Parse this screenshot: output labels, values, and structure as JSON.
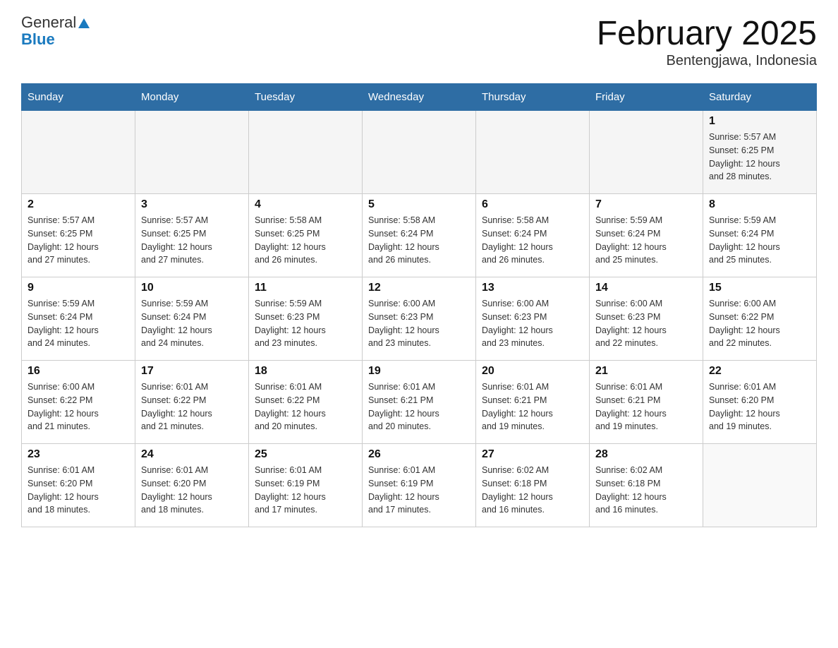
{
  "header": {
    "logo": {
      "general": "General",
      "blue": "Blue"
    },
    "title": "February 2025",
    "subtitle": "Bentengjawa, Indonesia"
  },
  "days_of_week": [
    "Sunday",
    "Monday",
    "Tuesday",
    "Wednesday",
    "Thursday",
    "Friday",
    "Saturday"
  ],
  "weeks": [
    {
      "days": [
        {
          "date": "",
          "info": ""
        },
        {
          "date": "",
          "info": ""
        },
        {
          "date": "",
          "info": ""
        },
        {
          "date": "",
          "info": ""
        },
        {
          "date": "",
          "info": ""
        },
        {
          "date": "",
          "info": ""
        },
        {
          "date": "1",
          "sunrise": "5:57 AM",
          "sunset": "6:25 PM",
          "daylight": "12 hours and 28 minutes."
        }
      ]
    },
    {
      "days": [
        {
          "date": "2",
          "sunrise": "5:57 AM",
          "sunset": "6:25 PM",
          "daylight": "12 hours and 27 minutes."
        },
        {
          "date": "3",
          "sunrise": "5:57 AM",
          "sunset": "6:25 PM",
          "daylight": "12 hours and 27 minutes."
        },
        {
          "date": "4",
          "sunrise": "5:58 AM",
          "sunset": "6:25 PM",
          "daylight": "12 hours and 26 minutes."
        },
        {
          "date": "5",
          "sunrise": "5:58 AM",
          "sunset": "6:24 PM",
          "daylight": "12 hours and 26 minutes."
        },
        {
          "date": "6",
          "sunrise": "5:58 AM",
          "sunset": "6:24 PM",
          "daylight": "12 hours and 26 minutes."
        },
        {
          "date": "7",
          "sunrise": "5:59 AM",
          "sunset": "6:24 PM",
          "daylight": "12 hours and 25 minutes."
        },
        {
          "date": "8",
          "sunrise": "5:59 AM",
          "sunset": "6:24 PM",
          "daylight": "12 hours and 25 minutes."
        }
      ]
    },
    {
      "days": [
        {
          "date": "9",
          "sunrise": "5:59 AM",
          "sunset": "6:24 PM",
          "daylight": "12 hours and 24 minutes."
        },
        {
          "date": "10",
          "sunrise": "5:59 AM",
          "sunset": "6:24 PM",
          "daylight": "12 hours and 24 minutes."
        },
        {
          "date": "11",
          "sunrise": "5:59 AM",
          "sunset": "6:23 PM",
          "daylight": "12 hours and 23 minutes."
        },
        {
          "date": "12",
          "sunrise": "6:00 AM",
          "sunset": "6:23 PM",
          "daylight": "12 hours and 23 minutes."
        },
        {
          "date": "13",
          "sunrise": "6:00 AM",
          "sunset": "6:23 PM",
          "daylight": "12 hours and 23 minutes."
        },
        {
          "date": "14",
          "sunrise": "6:00 AM",
          "sunset": "6:23 PM",
          "daylight": "12 hours and 22 minutes."
        },
        {
          "date": "15",
          "sunrise": "6:00 AM",
          "sunset": "6:22 PM",
          "daylight": "12 hours and 22 minutes."
        }
      ]
    },
    {
      "days": [
        {
          "date": "16",
          "sunrise": "6:00 AM",
          "sunset": "6:22 PM",
          "daylight": "12 hours and 21 minutes."
        },
        {
          "date": "17",
          "sunrise": "6:01 AM",
          "sunset": "6:22 PM",
          "daylight": "12 hours and 21 minutes."
        },
        {
          "date": "18",
          "sunrise": "6:01 AM",
          "sunset": "6:22 PM",
          "daylight": "12 hours and 20 minutes."
        },
        {
          "date": "19",
          "sunrise": "6:01 AM",
          "sunset": "6:21 PM",
          "daylight": "12 hours and 20 minutes."
        },
        {
          "date": "20",
          "sunrise": "6:01 AM",
          "sunset": "6:21 PM",
          "daylight": "12 hours and 19 minutes."
        },
        {
          "date": "21",
          "sunrise": "6:01 AM",
          "sunset": "6:21 PM",
          "daylight": "12 hours and 19 minutes."
        },
        {
          "date": "22",
          "sunrise": "6:01 AM",
          "sunset": "6:20 PM",
          "daylight": "12 hours and 19 minutes."
        }
      ]
    },
    {
      "days": [
        {
          "date": "23",
          "sunrise": "6:01 AM",
          "sunset": "6:20 PM",
          "daylight": "12 hours and 18 minutes."
        },
        {
          "date": "24",
          "sunrise": "6:01 AM",
          "sunset": "6:20 PM",
          "daylight": "12 hours and 18 minutes."
        },
        {
          "date": "25",
          "sunrise": "6:01 AM",
          "sunset": "6:19 PM",
          "daylight": "12 hours and 17 minutes."
        },
        {
          "date": "26",
          "sunrise": "6:01 AM",
          "sunset": "6:19 PM",
          "daylight": "12 hours and 17 minutes."
        },
        {
          "date": "27",
          "sunrise": "6:02 AM",
          "sunset": "6:18 PM",
          "daylight": "12 hours and 16 minutes."
        },
        {
          "date": "28",
          "sunrise": "6:02 AM",
          "sunset": "6:18 PM",
          "daylight": "12 hours and 16 minutes."
        },
        {
          "date": "",
          "info": ""
        }
      ]
    }
  ]
}
